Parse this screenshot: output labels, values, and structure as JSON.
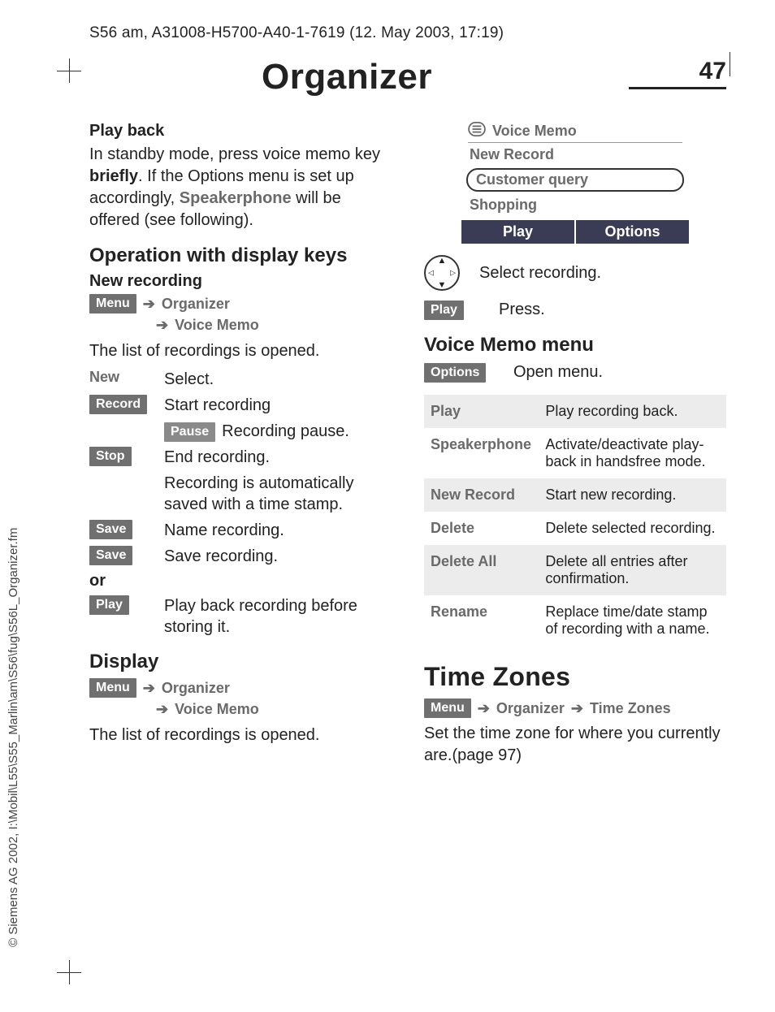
{
  "header": "S56 am, A31008-H5700-A40-1-7619 (12. May 2003, 17:19)",
  "side_copyright": "© Siemens AG 2002, I:\\Mobil\\L55\\S55_Marlin\\am\\S56\\fug\\S56L_Organizer.fm",
  "title": "Organizer",
  "page_number": "47",
  "left": {
    "playback_h": "Play back",
    "playback_body_1": "In standby mode, press voice memo key ",
    "playback_body_bold": "briefly",
    "playback_body_2": ". If the Options menu is set up accordingly, ",
    "playback_body_gray": "Speakerphone",
    "playback_body_3": " will be offered (see following).",
    "op_h": "Operation with display keys",
    "newrec_h": "New recording",
    "nav_menu": "Menu",
    "nav_org": "Organizer",
    "nav_vm": "Voice Memo",
    "list_opened": "The list of recordings is opened.",
    "steps": {
      "new_k": "New",
      "new_d": "Select.",
      "record_k": "Record",
      "record_d": "Start recording",
      "pause_k": "Pause",
      "pause_d": "Recording pause.",
      "stop_k": "Stop",
      "stop_d": "End recording.",
      "stop_d2": "Recording is automatically saved with a time stamp.",
      "save1_k": "Save",
      "save1_d": "Name recording.",
      "save2_k": "Save",
      "save2_d": "Save recording.",
      "or": "or",
      "play_k": "Play",
      "play_d": "Play back recording before storing it."
    },
    "display_h": "Display",
    "list_opened2": "The list of recordings is opened."
  },
  "right": {
    "phone": {
      "title": "Voice Memo",
      "items": [
        "New Record",
        "Customer query",
        "Shopping"
      ],
      "soft_left": "Play",
      "soft_right": "Options"
    },
    "sel_rec": "Select recording.",
    "play_k": "Play",
    "press": "Press.",
    "vm_menu_h": "Voice Memo menu",
    "options_k": "Options",
    "open_menu": "Open menu.",
    "table": [
      {
        "k": "Play",
        "v": "Play recording back."
      },
      {
        "k": "Speaker­phone",
        "v": "Activate/deactivate play­back in handsfree mode."
      },
      {
        "k": "New Record",
        "v": "Start new recording."
      },
      {
        "k": "Delete",
        "v": "Delete selected recording."
      },
      {
        "k": "Delete All",
        "v": "Delete all entries after con­firmation."
      },
      {
        "k": "Rename",
        "v": "Replace time/date stamp of recording with a name."
      }
    ],
    "tz_h": "Time Zones",
    "tz_nav_menu": "Menu",
    "tz_nav_org": "Organizer",
    "tz_nav_tz": "Time Zones",
    "tz_body": "Set the time zone for where you cur­rently are.(page 97)"
  }
}
